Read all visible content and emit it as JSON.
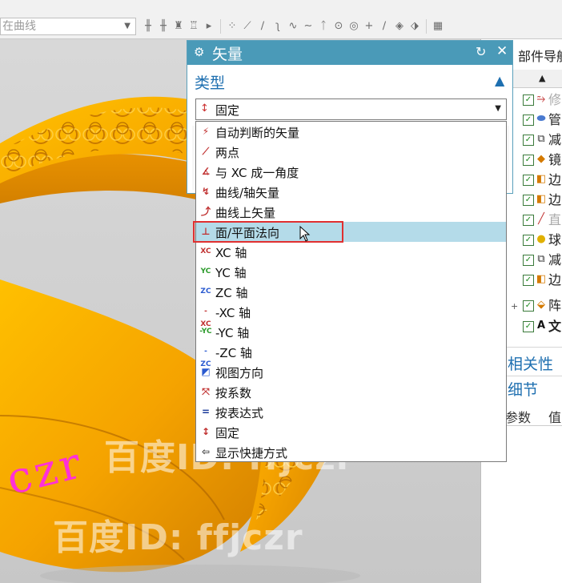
{
  "toolbar": {
    "curve_select_value": "在曲线"
  },
  "viewport": {
    "ring_text": "czr",
    "watermarks": [
      "百度ID: ffjczr",
      "百度ID: ffjczr"
    ]
  },
  "part_navigator": {
    "title": "部件导航",
    "header_label": " ",
    "tree_items": [
      {
        "label": "修"
      },
      {
        "label": "管"
      },
      {
        "label": "减"
      },
      {
        "label": "镜"
      },
      {
        "label": "边"
      },
      {
        "label": "边"
      },
      {
        "label": "直"
      },
      {
        "label": "球"
      },
      {
        "label": "减"
      },
      {
        "label": "边"
      },
      {
        "label": "阵"
      },
      {
        "label": "文"
      }
    ],
    "sections": [
      "相关性",
      "细节"
    ],
    "columns": [
      "参数",
      "值"
    ]
  },
  "dialog": {
    "title": "矢量",
    "section_type": "类型",
    "selected_value": "固定",
    "options": [
      {
        "label": "自动判断的矢量"
      },
      {
        "label": "两点"
      },
      {
        "label": "与 XC 成一角度"
      },
      {
        "label": "曲线/轴矢量"
      },
      {
        "label": "曲线上矢量"
      },
      {
        "label": "面/平面法向"
      },
      {
        "label": "XC 轴"
      },
      {
        "label": "YC 轴"
      },
      {
        "label": "ZC 轴"
      },
      {
        "label": "-XC 轴"
      },
      {
        "label": "-YC 轴"
      },
      {
        "label": "-ZC 轴"
      },
      {
        "label": "视图方向"
      },
      {
        "label": "按系数"
      },
      {
        "label": "按表达式"
      },
      {
        "label": "固定"
      },
      {
        "label": "显示快捷方式"
      }
    ],
    "highlighted_option": "面/平面法向"
  },
  "colors": {
    "dialog_title_bg": "#4a9ab8",
    "highlight_bg": "#b4dbe9",
    "annotation_red": "#e03030",
    "ring_gold": "#f5a300"
  }
}
